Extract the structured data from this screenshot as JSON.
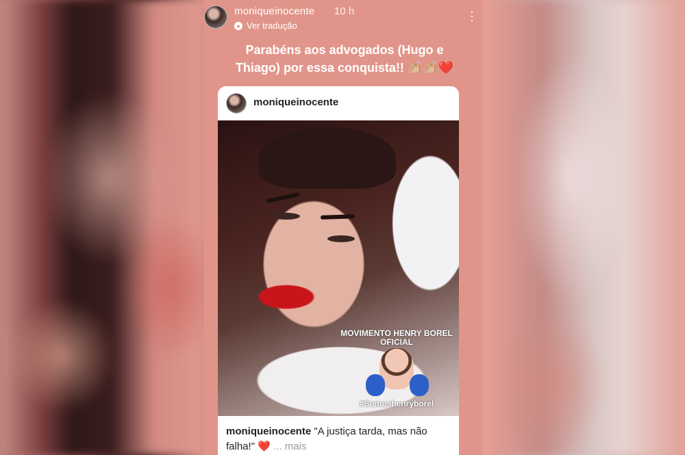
{
  "story": {
    "username": "moniqueinocente",
    "time": "10 h",
    "translate_label": "Ver tradução",
    "caption_line1": "Parabéns aos advogados (Hugo e",
    "caption_line2": "Thiago) por essa conquista!!",
    "caption_emojis": "👏🏼👏🏼❤️"
  },
  "post": {
    "username": "moniqueinocente",
    "sticker_title_line1": "MOVIMENTO HENRY BOREL",
    "sticker_title_line2": "OFICIAL",
    "sticker_hashtag": "#Somoshenryborel",
    "footer_username": "moniqueinocente",
    "footer_text": "\"A justiça tarda, mas não falha!\"",
    "footer_heart": "❤️",
    "footer_more": "... mais"
  },
  "colors": {
    "story_background": "#e1958a",
    "heart": "#d0111c"
  }
}
